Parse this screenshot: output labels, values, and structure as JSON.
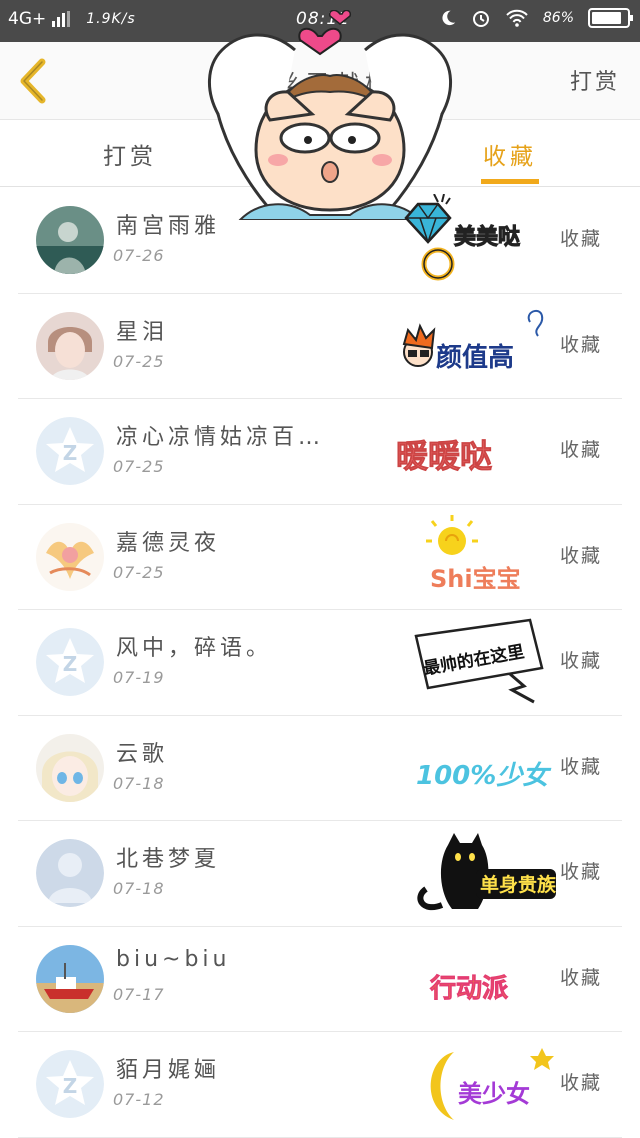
{
  "status_bar": {
    "network": "4G+",
    "speed": "1.9K/s",
    "time": "08:11",
    "battery": "86%",
    "battery_level": 0.86
  },
  "header": {
    "title": "粉丝贡献榜",
    "right_label": "打赏"
  },
  "tabs": [
    {
      "label": "打赏",
      "active": false
    },
    {
      "label": "收藏",
      "active": true
    }
  ],
  "accent_color": "#f1a91b",
  "users": [
    {
      "name": "南宫雨雅",
      "date": "07-26",
      "action": "收藏",
      "badge_text": "美美哒",
      "avatar": "photo-avatar"
    },
    {
      "name": "星泪",
      "date": "07-25",
      "action": "收藏",
      "badge_text": "颜值高",
      "avatar": "photo-avatar"
    },
    {
      "name": "凉心凉情姑凉百…",
      "date": "07-25",
      "action": "收藏",
      "badge_text": "暖暖哒",
      "avatar": "default-qzone-avatar"
    },
    {
      "name": "嘉德灵夜",
      "date": "07-25",
      "action": "收藏",
      "badge_text": "Shi宝宝",
      "avatar": "photo-avatar"
    },
    {
      "name": "风中，碎语。",
      "date": "07-19",
      "action": "收藏",
      "badge_text": "最帅的在这里",
      "avatar": "default-qzone-avatar"
    },
    {
      "name": "云歌",
      "date": "07-18",
      "action": "收藏",
      "badge_text": "100%少女",
      "avatar": "photo-avatar"
    },
    {
      "name": "北巷梦夏",
      "date": "07-18",
      "action": "收藏",
      "badge_text": "单身贵族",
      "avatar": "default-person-avatar"
    },
    {
      "name": "biu~biu",
      "date": "07-17",
      "action": "收藏",
      "badge_text": "行动派",
      "avatar": "photo-avatar"
    },
    {
      "name": "貊月娓婳",
      "date": "07-12",
      "action": "收藏",
      "badge_text": "美少女",
      "avatar": "default-qzone-avatar"
    }
  ]
}
